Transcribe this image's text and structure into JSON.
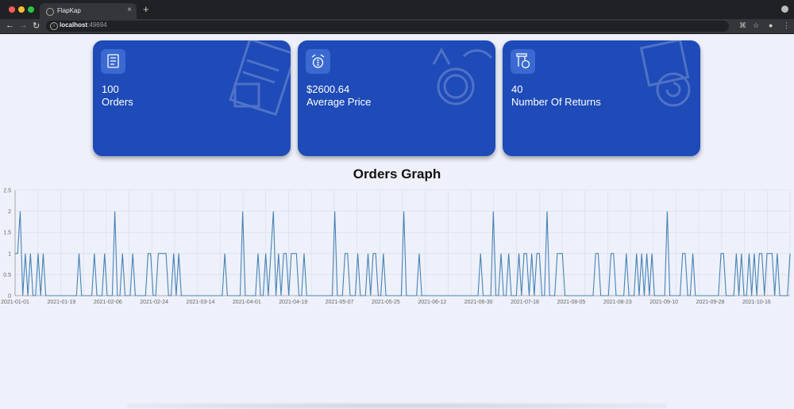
{
  "browser": {
    "tab_title": "FlapKap",
    "url_host": "localhost",
    "url_port": ":49694"
  },
  "cards": [
    {
      "value": "100",
      "label": "Orders",
      "icon": "orders-checklist-icon"
    },
    {
      "value": "$2600.64",
      "label": "Average Price",
      "icon": "price-money-icon"
    },
    {
      "value": "40",
      "label": "Number Of Returns",
      "icon": "returns-box-icon"
    }
  ],
  "colors": {
    "card_bg": "#1e4bb8",
    "line": "#4682b4",
    "page_bg": "#eef1fb"
  },
  "graph_title": "Orders Graph",
  "chart_data": {
    "type": "line",
    "title": "Orders Graph",
    "xlabel": "",
    "ylabel": "",
    "ylim": [
      0,
      2.5
    ],
    "yticks": [
      0,
      0.5,
      1,
      1.5,
      2,
      2.5
    ],
    "xticks": [
      "2021-01-01",
      "2021-01-19",
      "2021-02-06",
      "2021-02-24",
      "2021-03-14",
      "2021-04-01",
      "2021-04-19",
      "2021-05-07",
      "2021-05-25",
      "2021-06-12",
      "2021-06-30",
      "2021-07-18",
      "2021-08-05",
      "2021-08-23",
      "2021-09-10",
      "2021-09-28",
      "2021-10-16"
    ],
    "x_start": "2021-01-01",
    "x_end": "2021-10-29",
    "grid": true,
    "values": [
      1,
      1,
      2,
      0,
      1,
      0,
      1,
      0,
      0,
      1,
      0,
      1,
      0,
      0,
      0,
      0,
      0,
      0,
      0,
      0,
      0,
      0,
      0,
      0,
      0,
      1,
      0,
      0,
      0,
      0,
      0,
      1,
      0,
      0,
      0,
      1,
      0,
      0,
      0,
      2,
      0,
      0,
      1,
      0,
      0,
      0,
      1,
      0,
      0,
      0,
      0,
      0,
      1,
      1,
      0,
      0,
      1,
      1,
      1,
      1,
      0,
      0,
      1,
      0,
      1,
      0,
      0,
      0,
      0,
      0,
      0,
      0,
      0,
      0,
      0,
      0,
      0,
      0,
      0,
      0,
      0,
      0,
      1,
      0,
      0,
      0,
      0,
      0,
      0,
      2,
      0,
      0,
      0,
      0,
      0,
      1,
      0,
      0,
      1,
      0,
      1,
      2,
      0,
      1,
      0,
      1,
      1,
      0,
      1,
      1,
      1,
      0,
      0,
      1,
      0,
      0,
      0,
      0,
      0,
      0,
      0,
      0,
      0,
      0,
      0,
      2,
      0,
      0,
      0,
      1,
      1,
      0,
      0,
      0,
      1,
      0,
      0,
      0,
      1,
      0,
      1,
      1,
      0,
      0,
      1,
      0,
      0,
      0,
      0,
      0,
      0,
      0,
      2,
      0,
      0,
      0,
      0,
      0,
      1,
      0,
      0,
      0,
      0,
      0,
      0,
      0,
      0,
      0,
      0,
      0,
      0,
      0,
      0,
      0,
      0,
      0,
      0,
      0,
      0,
      0,
      0,
      0,
      1,
      0,
      0,
      0,
      0,
      2,
      0,
      0,
      1,
      0,
      0,
      1,
      0,
      0,
      0,
      1,
      0,
      1,
      1,
      0,
      1,
      0,
      1,
      1,
      0,
      0,
      2,
      0,
      0,
      0,
      1,
      1,
      1,
      0,
      0,
      0,
      0,
      0,
      0,
      0,
      0,
      0,
      0,
      0,
      0,
      1,
      1,
      0,
      0,
      0,
      0,
      1,
      1,
      0,
      0,
      0,
      0,
      1,
      0,
      0,
      0,
      1,
      0,
      1,
      0,
      1,
      0,
      1,
      0,
      0,
      0,
      0,
      0,
      2,
      0,
      0,
      0,
      0,
      0,
      1,
      1,
      0,
      0,
      1,
      0,
      0,
      0,
      0,
      0,
      0,
      0,
      0,
      0,
      0,
      1,
      1,
      0,
      0,
      0,
      0,
      1,
      0,
      1,
      0,
      0,
      1,
      0,
      1,
      0,
      1,
      1,
      0,
      1,
      1,
      1,
      0,
      1,
      0,
      0,
      0,
      0,
      1
    ]
  }
}
